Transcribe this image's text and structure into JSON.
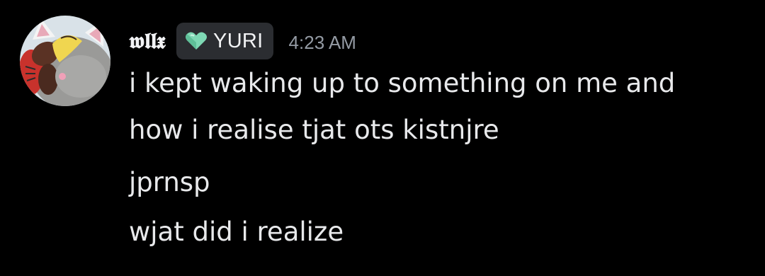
{
  "message": {
    "author": {
      "name": "𝖜𝖑𝖑𝖝",
      "tag": {
        "label": "YURI",
        "icon": "heart-icon",
        "icon_color": "#7ed8b4"
      }
    },
    "timestamp": "4:23 AM",
    "lines": [
      "i kept waking up to something on me and",
      "how i realise tjat ots kistnjre",
      "jprnsp",
      "wjat did i realize"
    ]
  },
  "colors": {
    "background": "#000000",
    "text_primary": "#e8e9eb",
    "text_muted": "#949ba4",
    "tag_background": "#2b2d31"
  }
}
